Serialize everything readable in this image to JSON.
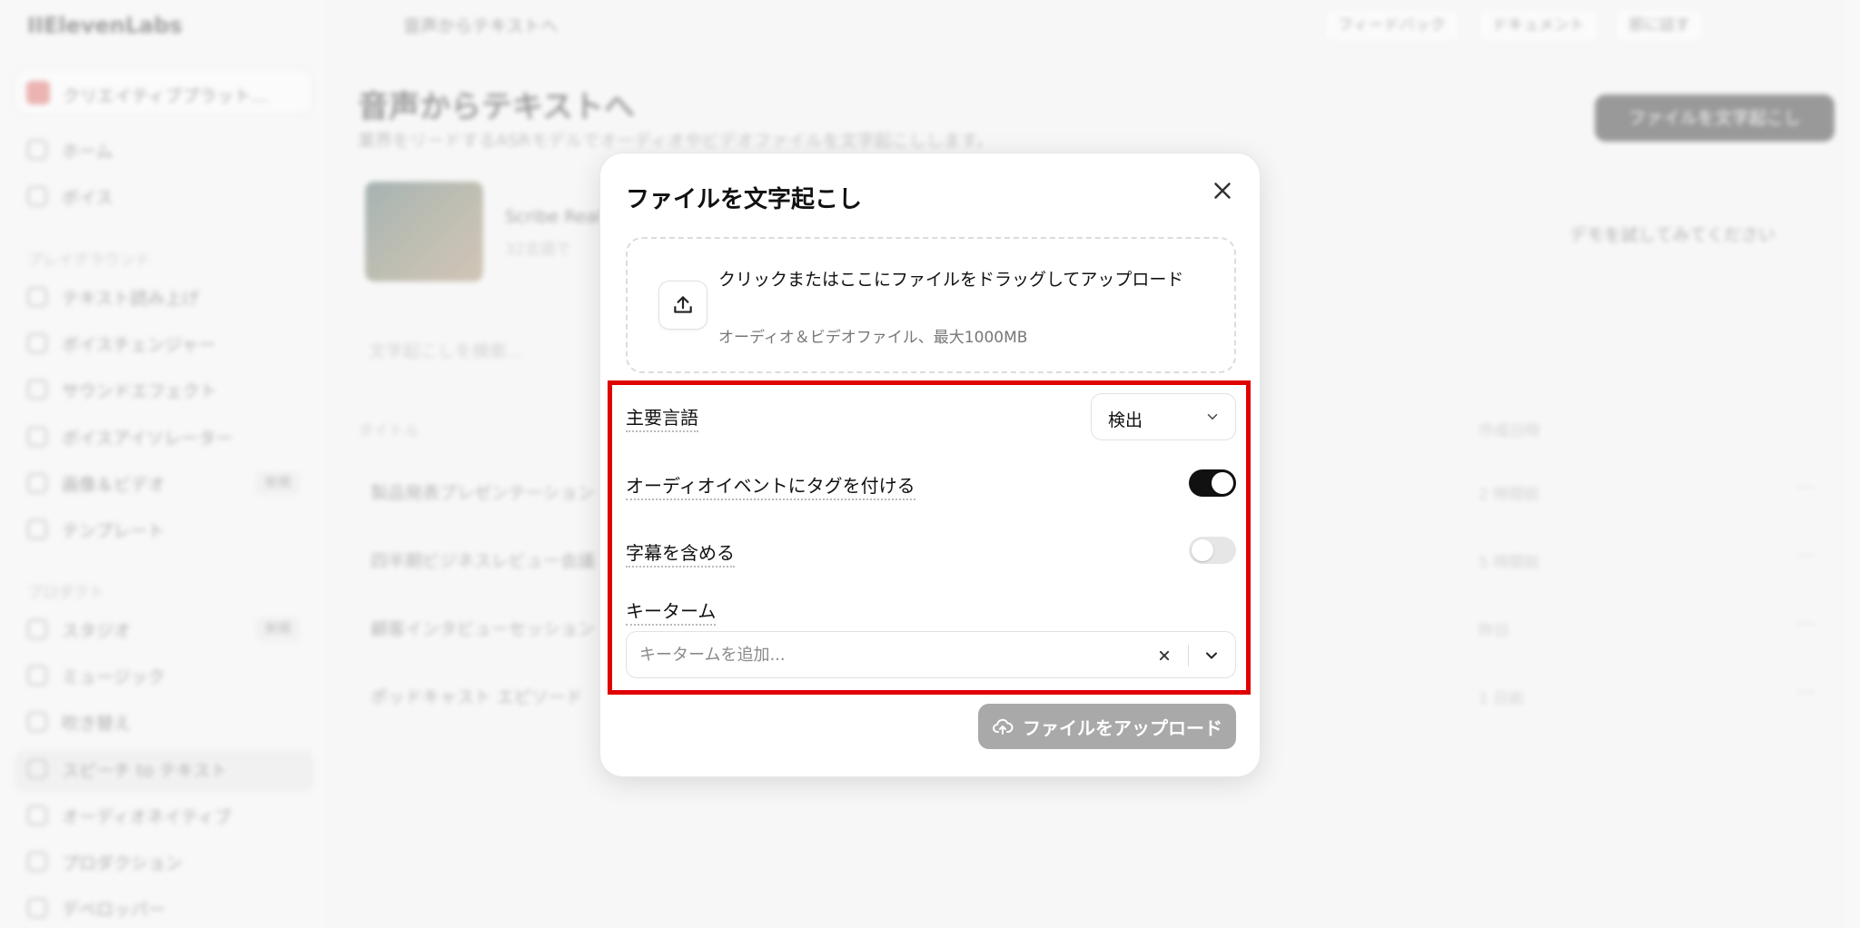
{
  "app": {
    "logo": "IIElevenLabs",
    "workspace": "クリエイティブプラット...",
    "breadcrumb": "音声からテキストへ"
  },
  "sidebar": {
    "items": [
      {
        "label": "ホーム"
      },
      {
        "label": "ボイス"
      },
      {
        "label": "テキスト読み上げ"
      },
      {
        "label": "ボイスチェンジャー"
      },
      {
        "label": "サウンドエフェクト"
      },
      {
        "label": "ボイスアイソレーター"
      },
      {
        "label": "画像＆ビデオ",
        "badge": "新規"
      },
      {
        "label": "テンプレート"
      },
      {
        "label": "スタジオ",
        "badge": "新規"
      },
      {
        "label": "ミュージック"
      },
      {
        "label": "吹き替え"
      },
      {
        "label": "スピーチ to テキスト"
      },
      {
        "label": "オーディオネイティブ"
      },
      {
        "label": "プロダクション"
      },
      {
        "label": "デベロッパー"
      }
    ],
    "sections": [
      "プレイグラウンド",
      "プロダクト"
    ]
  },
  "topbar": {
    "feedback": "フィードバック",
    "docs": "ドキュメント",
    "talk": "邪に話す"
  },
  "page": {
    "title": "音声からテキストへ",
    "subtitle": "業界をリードするASRモデルでオーディオやビデオファイルを文字起こしします。",
    "primary_button": "ファイルを文字起こし",
    "card_title": "Scribe Real",
    "card_sub": "32言語で",
    "try_demo": "デモを試してみてください",
    "search_placeholder": "文字起こしを検索...",
    "col_title": "タイトル",
    "col_created": "作成日時",
    "rows": [
      {
        "title": "製品発表プレゼンテーション",
        "date": "2 時間前"
      },
      {
        "title": "四半期ビジネスレビュー会議",
        "date": "5 時間前"
      },
      {
        "title": "顧客インタビューセッション",
        "date": "昨日"
      },
      {
        "title": "ポッドキャスト エピソード",
        "date": "1 日前"
      }
    ]
  },
  "modal": {
    "title": "ファイルを文字起こし",
    "dropzone_title": "クリックまたはここにファイルをドラッグしてアップロード",
    "dropzone_sub": "オーディオ＆ビデオファイル、最大1000MB",
    "language_label": "主要言語",
    "language_value": "検出",
    "tag_events_label": "オーディオイベントにタグを付ける",
    "tag_events_on": true,
    "subtitles_label": "字幕を含める",
    "subtitles_on": false,
    "keyterms_label": "キーターム",
    "keyterms_placeholder": "キータームを追加...",
    "upload_button": "ファイルをアップロード"
  },
  "colors": {
    "highlight": "#e00000",
    "toggle_on": "#111111",
    "upload_disabled": "#a9a9a9"
  }
}
